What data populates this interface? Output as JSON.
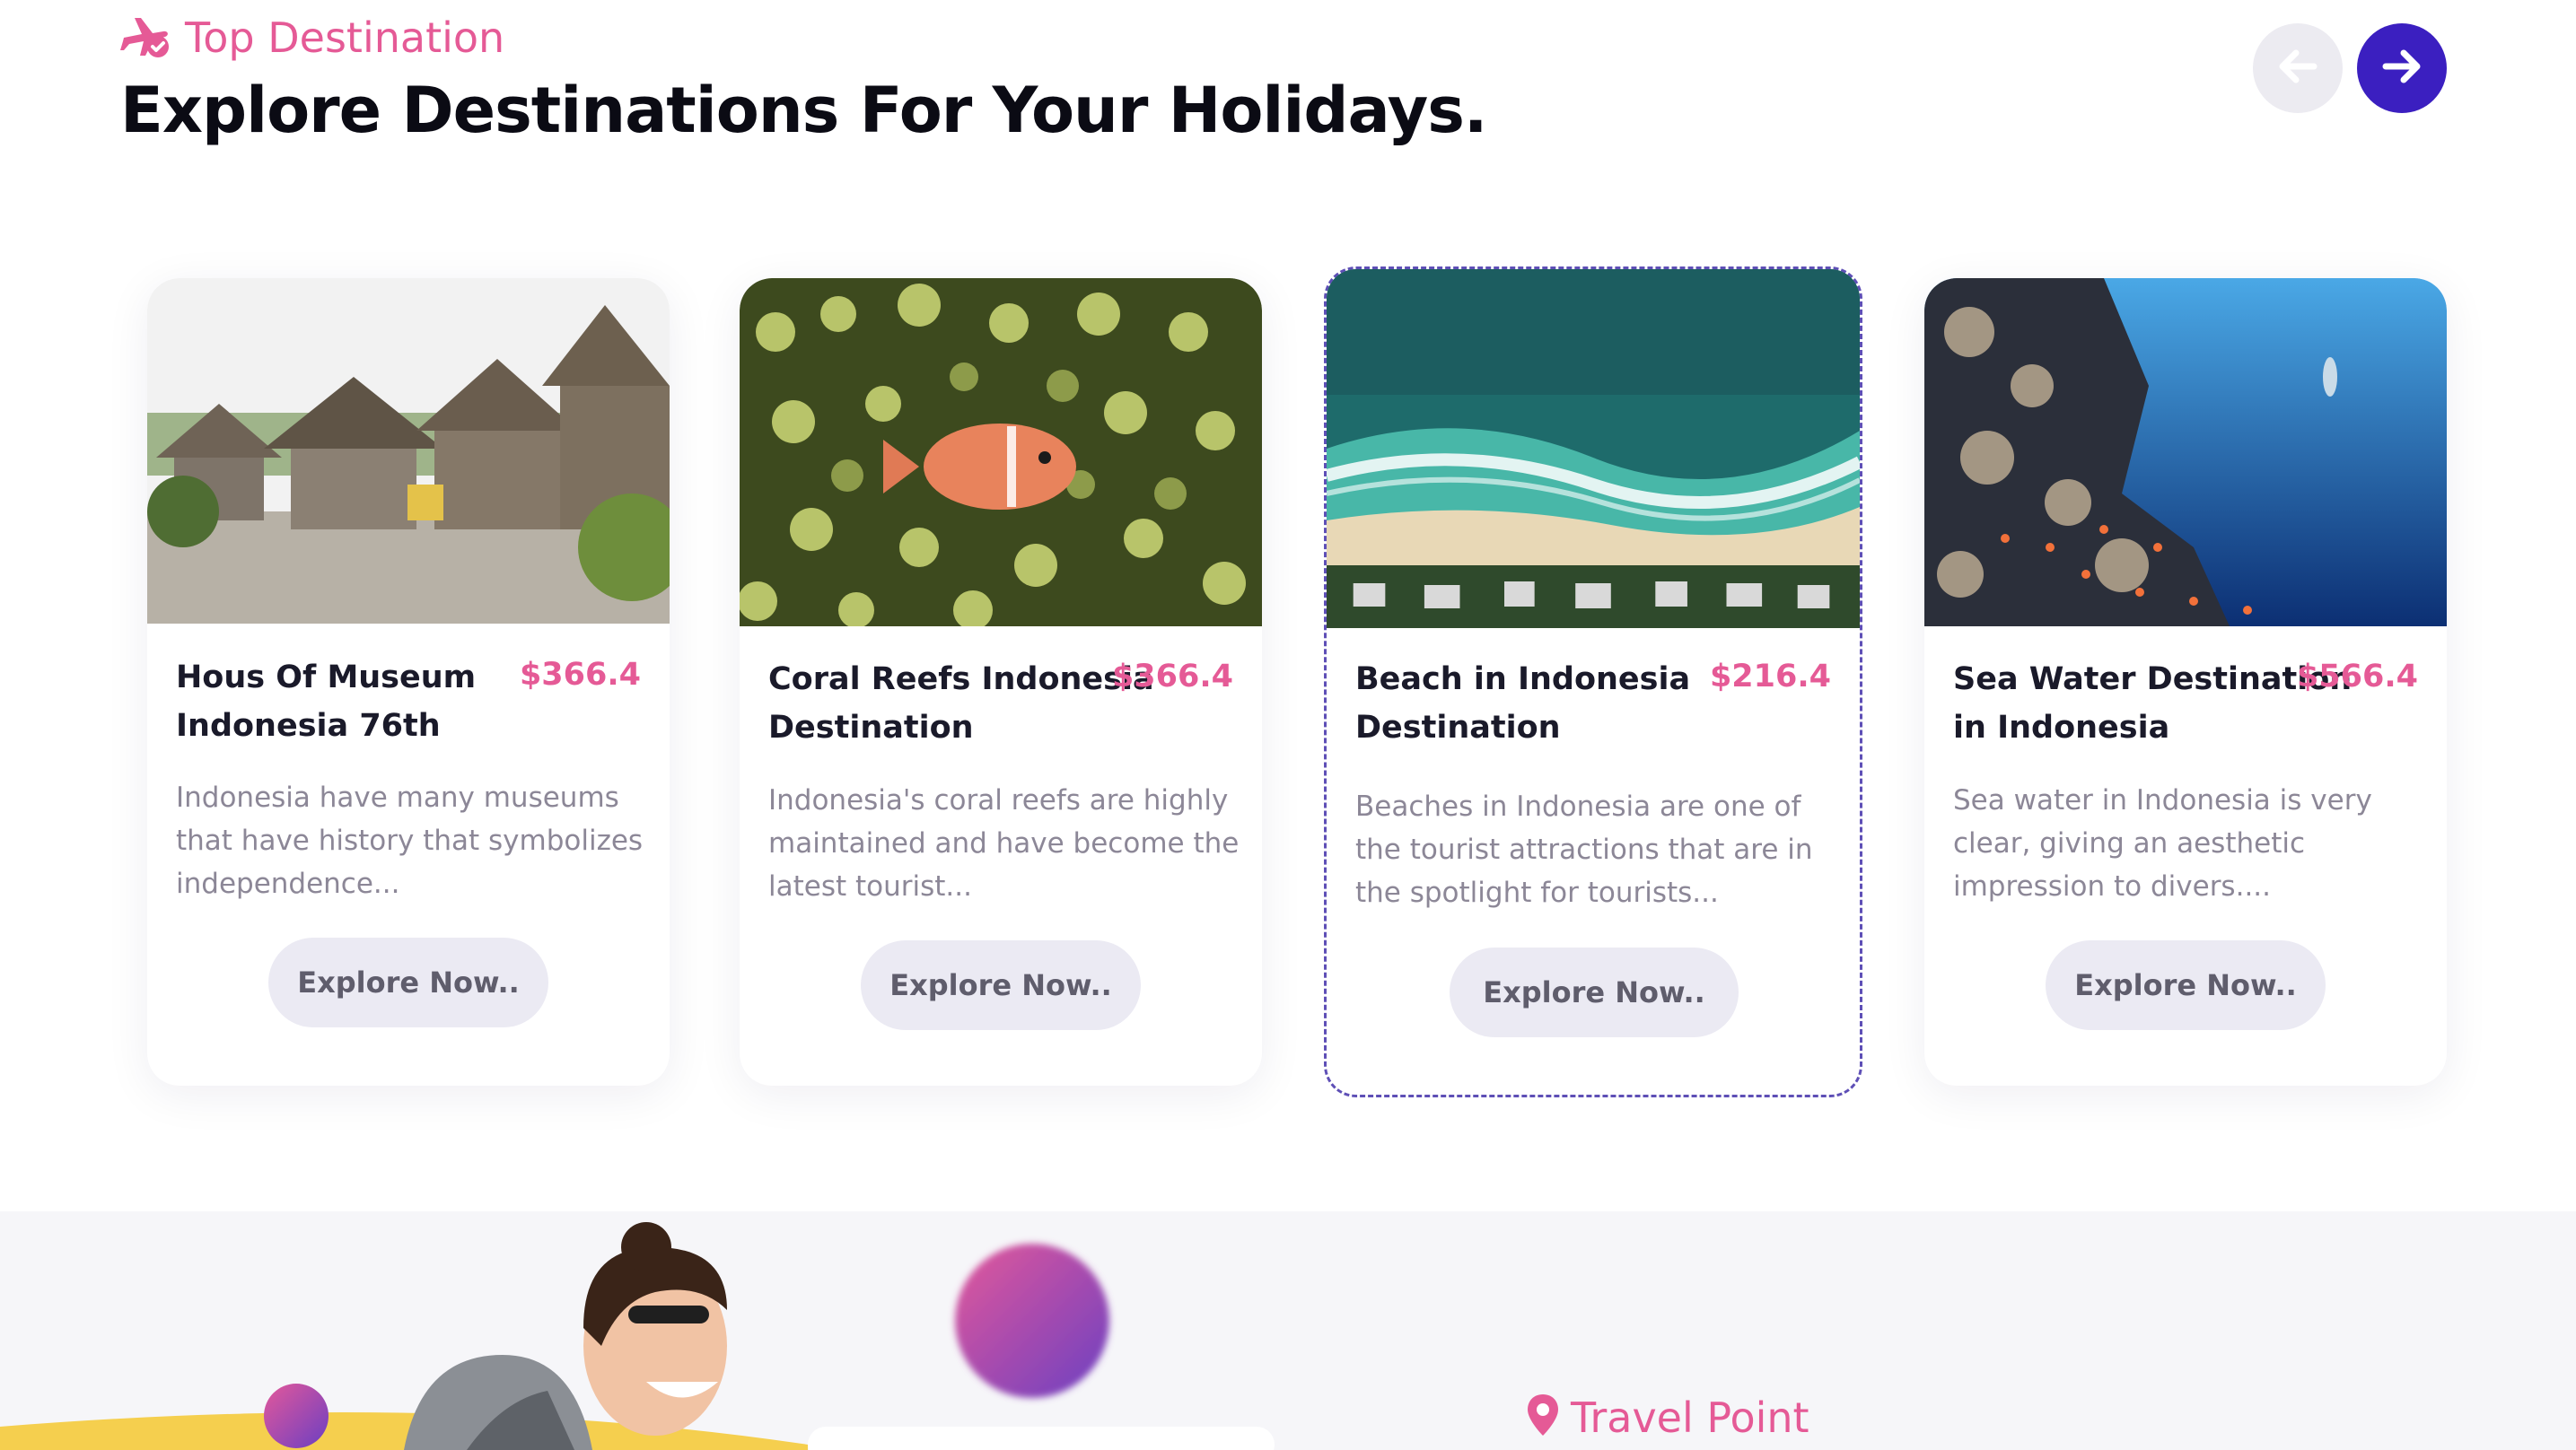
{
  "section": {
    "eyebrow": "Top Destination",
    "eyebrow_icon": "plane-check-icon",
    "title": "Explore Destinations For Your Holidays."
  },
  "nav": {
    "prev_icon": "arrow-left-icon",
    "next_icon": "arrow-right-icon"
  },
  "cards": [
    {
      "title_line1": "Hous Of Museum",
      "title_line2": "Indonesia 76th",
      "price": "$366.4",
      "desc_line1": "Indonesia have many museums",
      "desc_line2": "that have history that symbolizes",
      "desc_line3": "independence...",
      "cta": "Explore Now..",
      "image": "balinese-museum-photo"
    },
    {
      "title_line1": "Coral Reefs Indonesia",
      "title_line2": "Destination",
      "price": "$366.4",
      "desc_line1": "Indonesia's coral reefs are highly",
      "desc_line2": "maintained and have become the",
      "desc_line3": "latest tourist...",
      "cta": "Explore Now..",
      "image": "clownfish-anemone-photo"
    },
    {
      "title_line1": "Beach in Indonesia",
      "title_line2": "Destination",
      "price": "$216.4",
      "desc_line1": "Beaches in Indonesia are one of",
      "desc_line2": "the tourist attractions that are in",
      "desc_line3": "the spotlight for tourists...",
      "cta": "Explore Now..",
      "image": "aerial-beach-photo"
    },
    {
      "title_line1": "Sea Water Destination",
      "title_line2": "in Indonesia",
      "price": "$566.4",
      "desc_line1": "Sea water in Indonesia is very",
      "desc_line2": "clear, giving an aesthetic",
      "desc_line3": "impression to divers....",
      "cta": "Explore Now..",
      "image": "underwater-reef-photo"
    }
  ],
  "travel_point": {
    "label": "Travel Point",
    "icon": "map-pin-icon"
  },
  "colors": {
    "accent_pink": "#e55a96",
    "accent_purple": "#3b1fc0",
    "button_bg": "#ebeaf3",
    "text_muted": "#8c8797"
  }
}
